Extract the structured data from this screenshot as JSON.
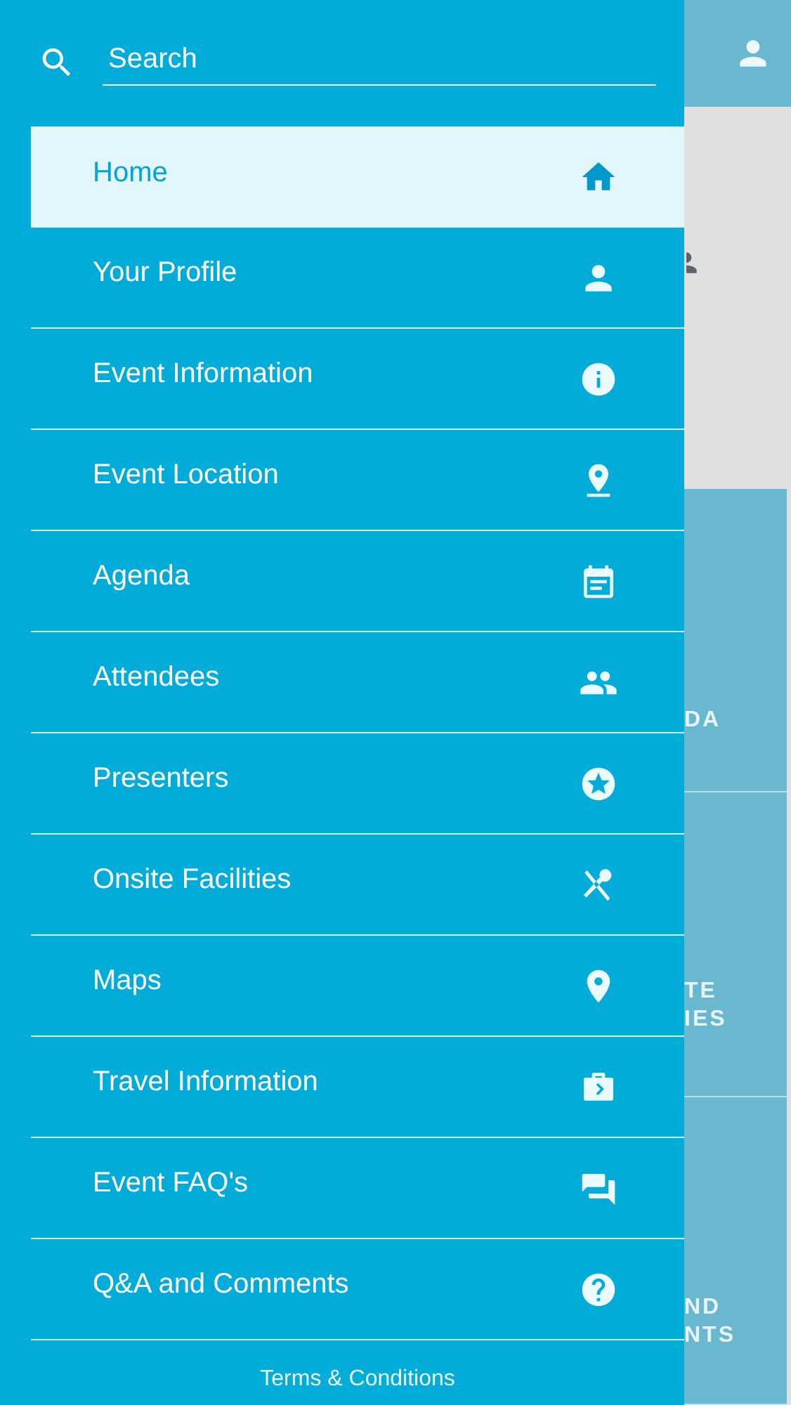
{
  "search": {
    "placeholder": "Search"
  },
  "menu": [
    {
      "label": "Home",
      "selected": true
    },
    {
      "label": "Your Profile",
      "selected": false
    },
    {
      "label": "Event Information",
      "selected": false
    },
    {
      "label": "Event Location",
      "selected": false
    },
    {
      "label": "Agenda",
      "selected": false
    },
    {
      "label": "Attendees",
      "selected": false
    },
    {
      "label": "Presenters",
      "selected": false
    },
    {
      "label": "Onsite Facilities",
      "selected": false
    },
    {
      "label": "Maps",
      "selected": false
    },
    {
      "label": "Travel Information",
      "selected": false
    },
    {
      "label": "Event FAQ's",
      "selected": false
    },
    {
      "label": "Q&A and Comments",
      "selected": false
    }
  ],
  "footer": {
    "link": "Terms & Conditions"
  },
  "background": {
    "tiles": [
      {
        "lines": [
          "DA"
        ]
      },
      {
        "lines": [
          "TE",
          "IES"
        ]
      },
      {
        "lines": [
          "ND",
          "NTS"
        ]
      }
    ]
  }
}
